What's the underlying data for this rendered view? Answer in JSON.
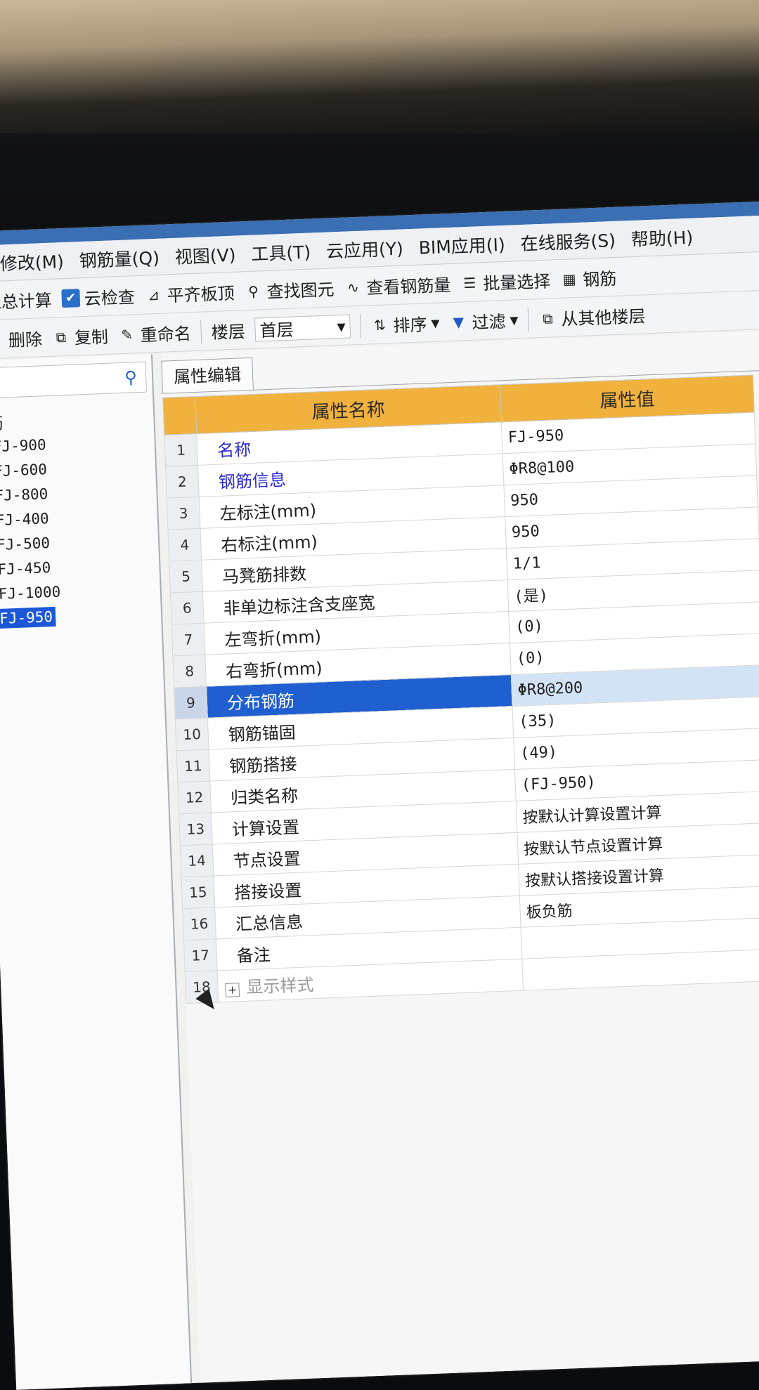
{
  "menu": [
    "修改(M)",
    "钢筋量(Q)",
    "视图(V)",
    "工具(T)",
    "云应用(Y)",
    "BIM应用(I)",
    "在线服务(S)",
    "帮助(H)"
  ],
  "toolbar1": {
    "sum_calc": "汇总计算",
    "cloud_check": "云检查",
    "align_slab": "平齐板顶",
    "find_element": "查找图元",
    "view_rebar": "查看钢筋量",
    "batch_select": "批量选择",
    "rebar_3d": "钢筋"
  },
  "toolbar2": {
    "delete": "删除",
    "copy": "复制",
    "rename": "重命名",
    "floor_label": "楼层",
    "floor_value": "首层",
    "sort": "排序",
    "filter": "过滤",
    "copy_from_floor": "从其他楼层"
  },
  "tree": {
    "header": "筋",
    "items": [
      "FJ-900",
      "FJ-600",
      "FJ-800",
      "FJ-400",
      "FJ-500",
      "FJ-450",
      "FJ-1000",
      "FJ-950"
    ],
    "selected": "FJ-950"
  },
  "panel": {
    "tab": "属性编辑",
    "col_name": "属性名称",
    "col_value": "属性值",
    "rows": [
      {
        "num": "1",
        "name": "名称",
        "value": "FJ-950"
      },
      {
        "num": "2",
        "name": "钢筋信息",
        "value": "ΦR8@100"
      },
      {
        "num": "3",
        "name": "左标注(mm)",
        "value": "950"
      },
      {
        "num": "4",
        "name": "右标注(mm)",
        "value": "950"
      },
      {
        "num": "5",
        "name": "马凳筋排数",
        "value": "1/1"
      },
      {
        "num": "6",
        "name": "非单边标注含支座宽",
        "value": "(是)"
      },
      {
        "num": "7",
        "name": "左弯折(mm)",
        "value": "(0)"
      },
      {
        "num": "8",
        "name": "右弯折(mm)",
        "value": "(0)"
      },
      {
        "num": "9",
        "name": "分布钢筋",
        "value": "ΦR8@200"
      },
      {
        "num": "10",
        "name": "钢筋锚固",
        "value": "(35)"
      },
      {
        "num": "11",
        "name": "钢筋搭接",
        "value": "(49)"
      },
      {
        "num": "12",
        "name": "归类名称",
        "value": "(FJ-950)"
      },
      {
        "num": "13",
        "name": "计算设置",
        "value": "按默认计算设置计算"
      },
      {
        "num": "14",
        "name": "节点设置",
        "value": "按默认节点设置计算"
      },
      {
        "num": "15",
        "name": "搭接设置",
        "value": "按默认搭接设置计算"
      },
      {
        "num": "16",
        "name": "汇总信息",
        "value": "板负筋"
      },
      {
        "num": "17",
        "name": "备注",
        "value": ""
      },
      {
        "num": "18",
        "name": "显示样式",
        "value": ""
      }
    ]
  },
  "colors": {
    "accent": "#1f5fd0",
    "header": "#f0b23c",
    "highlight_name": "#2a2ad0"
  }
}
